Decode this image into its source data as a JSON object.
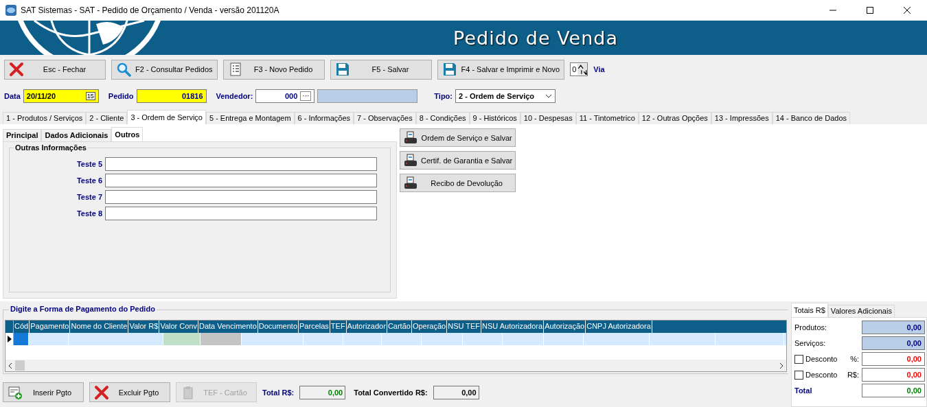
{
  "window": {
    "title": "SAT Sistemas - SAT - Pedido de Orçamento / Venda - versão 201120A"
  },
  "banner": {
    "title": "Pedido de Venda"
  },
  "toolbar": {
    "buttons": [
      {
        "label": "Esc - Fechar",
        "kind": "close"
      },
      {
        "label": "F2 - Consultar Pedidos",
        "kind": "search"
      },
      {
        "label": "F3 - Novo Pedido",
        "kind": "list"
      },
      {
        "label": "F5 - Salvar",
        "kind": "save"
      },
      {
        "label": "F4 - Salvar e Imprimir e Novo",
        "kind": "save"
      }
    ],
    "via": {
      "value": "0",
      "label": "Via"
    }
  },
  "header": {
    "data": {
      "label": "Data",
      "value": "20/11/20",
      "calendar": "15"
    },
    "pedido": {
      "label": "Pedido",
      "value": "01816"
    },
    "vendedor": {
      "label": "Vendedor:",
      "value": "000",
      "button": "···"
    },
    "tipo": {
      "label": "Tipo:",
      "value": "2 - Ordem de Serviço"
    }
  },
  "tabs": [
    {
      "label": "1 - Produtos / Serviços",
      "selected": false
    },
    {
      "label": "2 - Cliente",
      "selected": false
    },
    {
      "label": "3 - Ordem de Serviço",
      "selected": true
    },
    {
      "label": "5 - Entrega e Montagem",
      "selected": false
    },
    {
      "label": "6 - Informações",
      "selected": false
    },
    {
      "label": "7 - Observações",
      "selected": false
    },
    {
      "label": "8 - Condições",
      "selected": false
    },
    {
      "label": "9 - Históricos",
      "selected": false
    },
    {
      "label": "10 - Despesas",
      "selected": false
    },
    {
      "label": "11 - Tintometrico",
      "selected": false
    },
    {
      "label": "12 - Outras Opções",
      "selected": false
    },
    {
      "label": "13 - Impressões",
      "selected": false
    },
    {
      "label": "14 - Banco de Dados",
      "selected": false
    }
  ],
  "subtabs": [
    {
      "label": "Principal",
      "selected": false
    },
    {
      "label": "Dados Adicionais",
      "selected": false
    },
    {
      "label": "Outros",
      "selected": true
    }
  ],
  "outras": {
    "title": "Outras Informações",
    "fields": [
      {
        "label": "Teste 5"
      },
      {
        "label": "Teste 6"
      },
      {
        "label": "Teste 7"
      },
      {
        "label": "Teste 8"
      }
    ]
  },
  "print_buttons": [
    {
      "label": "Ordem de Serviço e Salvar"
    },
    {
      "label": "Certif. de Garantia e Salvar"
    },
    {
      "label": "Recibo de Devolução"
    }
  ],
  "payment": {
    "title": "Digite a Forma de Pagamento do Pedido",
    "columns": [
      "Cód",
      "Pagamento",
      "Nome do Cliente",
      "Valor R$",
      "Valor Conv",
      "Data Vencimento",
      "Documento",
      "Parcelas",
      "TEF",
      "Autorizador",
      "Cartão",
      "Operação",
      "NSU TEF",
      "NSU Autorizadora",
      "Autorização",
      "CNPJ Autorizadora"
    ]
  },
  "payment_buttons": [
    {
      "label": "Inserir Pgto",
      "kind": "add",
      "disabled": false
    },
    {
      "label": "Excluir Pgto",
      "kind": "close",
      "disabled": false
    },
    {
      "label": "TEF - Cartão",
      "kind": "clipboard",
      "disabled": true
    }
  ],
  "totals": {
    "total_label": "Total R$:",
    "total_value": "0,00",
    "conv_label": "Total Convertido R$:",
    "conv_value": "0,00"
  },
  "side_panel": {
    "tabs": [
      {
        "label": "Totais R$",
        "selected": true
      },
      {
        "label": "Valores Adicionais",
        "selected": false
      }
    ],
    "rows": [
      {
        "kind": "readonly",
        "label": "Produtos:",
        "value": "0,00"
      },
      {
        "kind": "readonly",
        "label": "Serviços:",
        "value": "0,00"
      },
      {
        "kind": "discount",
        "label": "Desconto",
        "unit": "%:",
        "checked": false,
        "value": "0,00"
      },
      {
        "kind": "discount",
        "label": "Desconto",
        "unit": "R$:",
        "checked": false,
        "value": "0,00"
      },
      {
        "kind": "total",
        "label": "Total",
        "value": "0,00"
      }
    ]
  }
}
